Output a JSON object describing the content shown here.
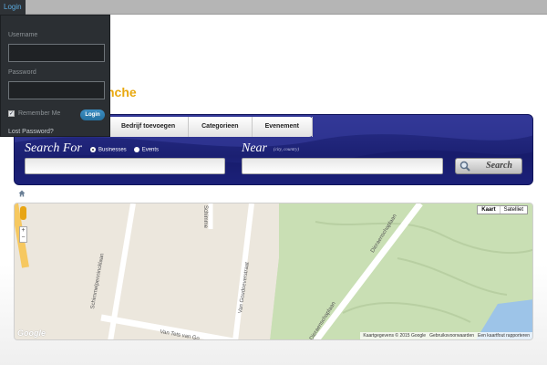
{
  "topbar": {
    "login_tab": "Login"
  },
  "logo": {
    "text": "nche",
    "color": "#e8a80f"
  },
  "login_panel": {
    "username_label": "Username",
    "username_value": "",
    "password_label": "Password",
    "password_value": "",
    "remember_label": "Remember Me",
    "remember_checked": true,
    "login_button": "Login",
    "lost_password": "Lost Password?"
  },
  "nav": {
    "items": [
      "Bedrijf toevoegen",
      "Categorieen",
      "Evenement"
    ]
  },
  "search": {
    "search_for_label": "Search For",
    "options": [
      "Businesses",
      "Events"
    ],
    "selected_option": "Businesses",
    "keyword_value": "",
    "near_label": "Near",
    "near_hint": "(city, country)",
    "near_value": "",
    "button_label": "Search"
  },
  "map": {
    "type_buttons": [
      "Kaart",
      "Satelliet"
    ],
    "active_type": "Kaart",
    "zoom_in": "+",
    "zoom_out": "−",
    "streets": [
      "Schimmelpennincklaan",
      "Van Goudoeverstraat",
      "Dieraenschaplaan",
      "Dieraenschaplaan",
      "Van Tets van Go",
      "Schimme"
    ],
    "google_logo": "Google",
    "attribution": [
      "Kaartgegevens © 2015 Google",
      "Gebruiksvoorwaarden",
      "Een kaartfout rapporteren"
    ]
  },
  "colors": {
    "accent_blue": "#1b2072",
    "login_button": "#2f7fb4",
    "park": "#c9dfb4",
    "water": "#9dc4e8"
  }
}
